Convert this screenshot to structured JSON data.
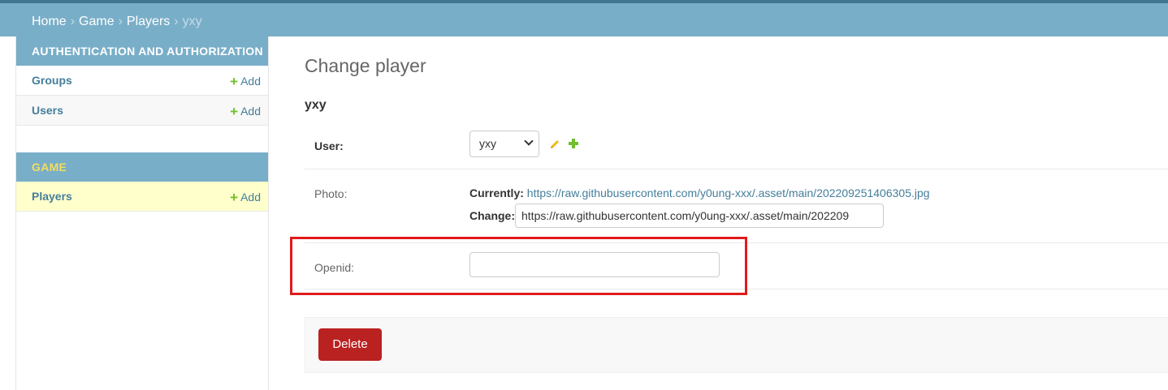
{
  "breadcrumbs": {
    "home": "Home",
    "game": "Game",
    "players": "Players",
    "current": "yxy",
    "separator": "›"
  },
  "sidebar": {
    "modules": [
      {
        "caption": "AUTHENTICATION AND AUTHORIZATION",
        "items": [
          {
            "label": "Groups",
            "add_label": "Add"
          },
          {
            "label": "Users",
            "add_label": "Add"
          }
        ]
      },
      {
        "caption": "GAME",
        "items": [
          {
            "label": "Players",
            "add_label": "Add",
            "selected": true
          }
        ]
      }
    ]
  },
  "main": {
    "title": "Change player",
    "object_title": "yxy",
    "fields": {
      "user": {
        "label": "User:",
        "selected_value": "yxy"
      },
      "photo": {
        "label": "Photo:",
        "currently_label": "Currently:",
        "currently_url": "https://raw.githubusercontent.com/y0ung-xxx/.asset/main/202209251406305.jpg",
        "change_label": "Change:",
        "change_value": "https://raw.githubusercontent.com/y0ung-xxx/.asset/main/202209"
      },
      "openid": {
        "label": "Openid:",
        "value": ""
      }
    },
    "delete_label": "Delete"
  },
  "colors": {
    "header": "#79aec8",
    "link": "#447e9b",
    "add_plus": "#70bf2b",
    "delete": "#ba2121",
    "highlight": "#e01b1b",
    "selected_row": "#ffffcc"
  }
}
